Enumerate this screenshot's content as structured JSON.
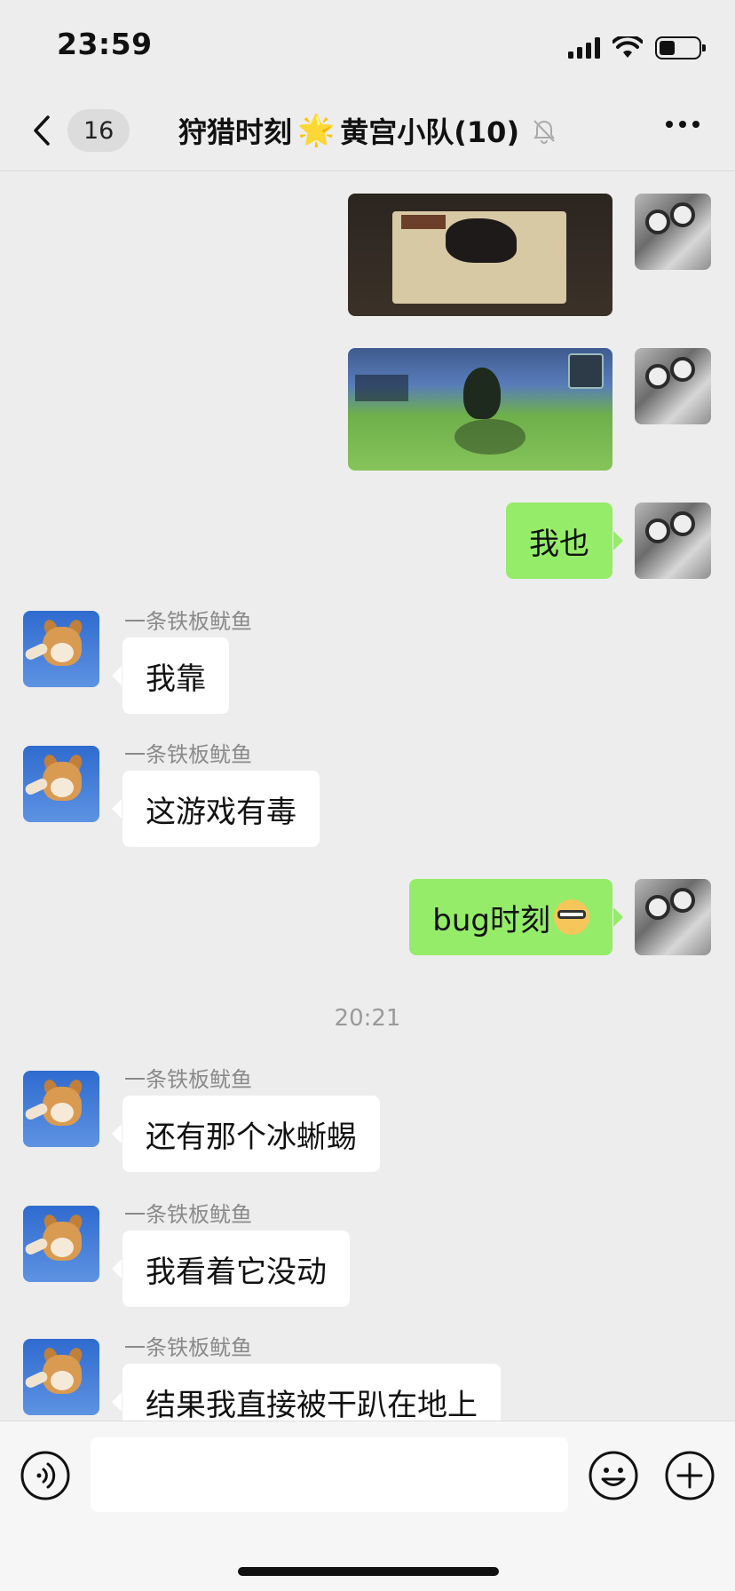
{
  "status_bar": {
    "time": "23:59"
  },
  "nav": {
    "unread_count": "16",
    "title_prefix": "狩猎时刻",
    "title_star": "🌟",
    "title_suffix": "黄宫小队(10)"
  },
  "messages": [
    {
      "side": "me",
      "type": "image",
      "desc_icon": "game-screenshot-hunting-panel"
    },
    {
      "side": "me",
      "type": "image",
      "desc_icon": "game-screenshot-field"
    },
    {
      "side": "me",
      "type": "text",
      "text": "我也"
    },
    {
      "side": "other",
      "sender": "一条铁板鱿鱼",
      "type": "text",
      "text": "我靠"
    },
    {
      "side": "other",
      "sender": "一条铁板鱿鱼",
      "type": "text",
      "text": "这游戏有毒"
    },
    {
      "side": "me",
      "type": "text",
      "text": "bug时刻",
      "emoji": "cool-doge-emoji"
    },
    {
      "type": "time",
      "text": "20:21"
    },
    {
      "side": "other",
      "sender": "一条铁板鱿鱼",
      "type": "text",
      "text": "还有那个冰蜥蜴"
    },
    {
      "side": "other",
      "sender": "一条铁板鱿鱼",
      "type": "text",
      "text": "我看着它没动"
    },
    {
      "side": "other",
      "sender": "一条铁板鱿鱼",
      "type": "text",
      "text": "结果我直接被干趴在地上"
    }
  ],
  "input": {
    "value": "",
    "placeholder": ""
  },
  "colors": {
    "me_bubble": "#95ec69",
    "other_bubble": "#ffffff",
    "background": "#ededed"
  }
}
